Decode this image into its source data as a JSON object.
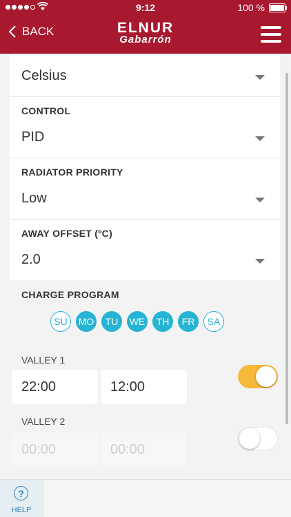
{
  "status_bar": {
    "time": "9:12",
    "battery": "100 %"
  },
  "nav": {
    "back_label": "BACK",
    "logo_line1": "ELNUR",
    "logo_line2": "Gabarrón"
  },
  "settings": {
    "units": {
      "value": "Celsius"
    },
    "control": {
      "label": "CONTROL",
      "value": "PID"
    },
    "radiator_priority": {
      "label": "RADIATOR PRIORITY",
      "value": "Low"
    },
    "away_offset": {
      "label": "AWAY OFFSET (ºC)",
      "value": "2.0"
    }
  },
  "charge_program": {
    "label": "CHARGE PROGRAM",
    "days": [
      {
        "label": "SU",
        "selected": false
      },
      {
        "label": "MO",
        "selected": true
      },
      {
        "label": "TU",
        "selected": true
      },
      {
        "label": "WE",
        "selected": true
      },
      {
        "label": "TH",
        "selected": true
      },
      {
        "label": "FR",
        "selected": true
      },
      {
        "label": "SA",
        "selected": false
      }
    ],
    "valleys": [
      {
        "label": "VALLEY 1",
        "start": "22:00",
        "end": "12:00",
        "enabled": true
      },
      {
        "label": "VALLEY 2",
        "start": "00:00",
        "end": "00:00",
        "enabled": false
      }
    ]
  },
  "bottom_bar": {
    "help_label": "HELP"
  },
  "colors": {
    "brand": "#a81930",
    "day_selected": "#27b3d3",
    "toggle_on": "#f6b93b",
    "help": "#2a7fb8"
  }
}
